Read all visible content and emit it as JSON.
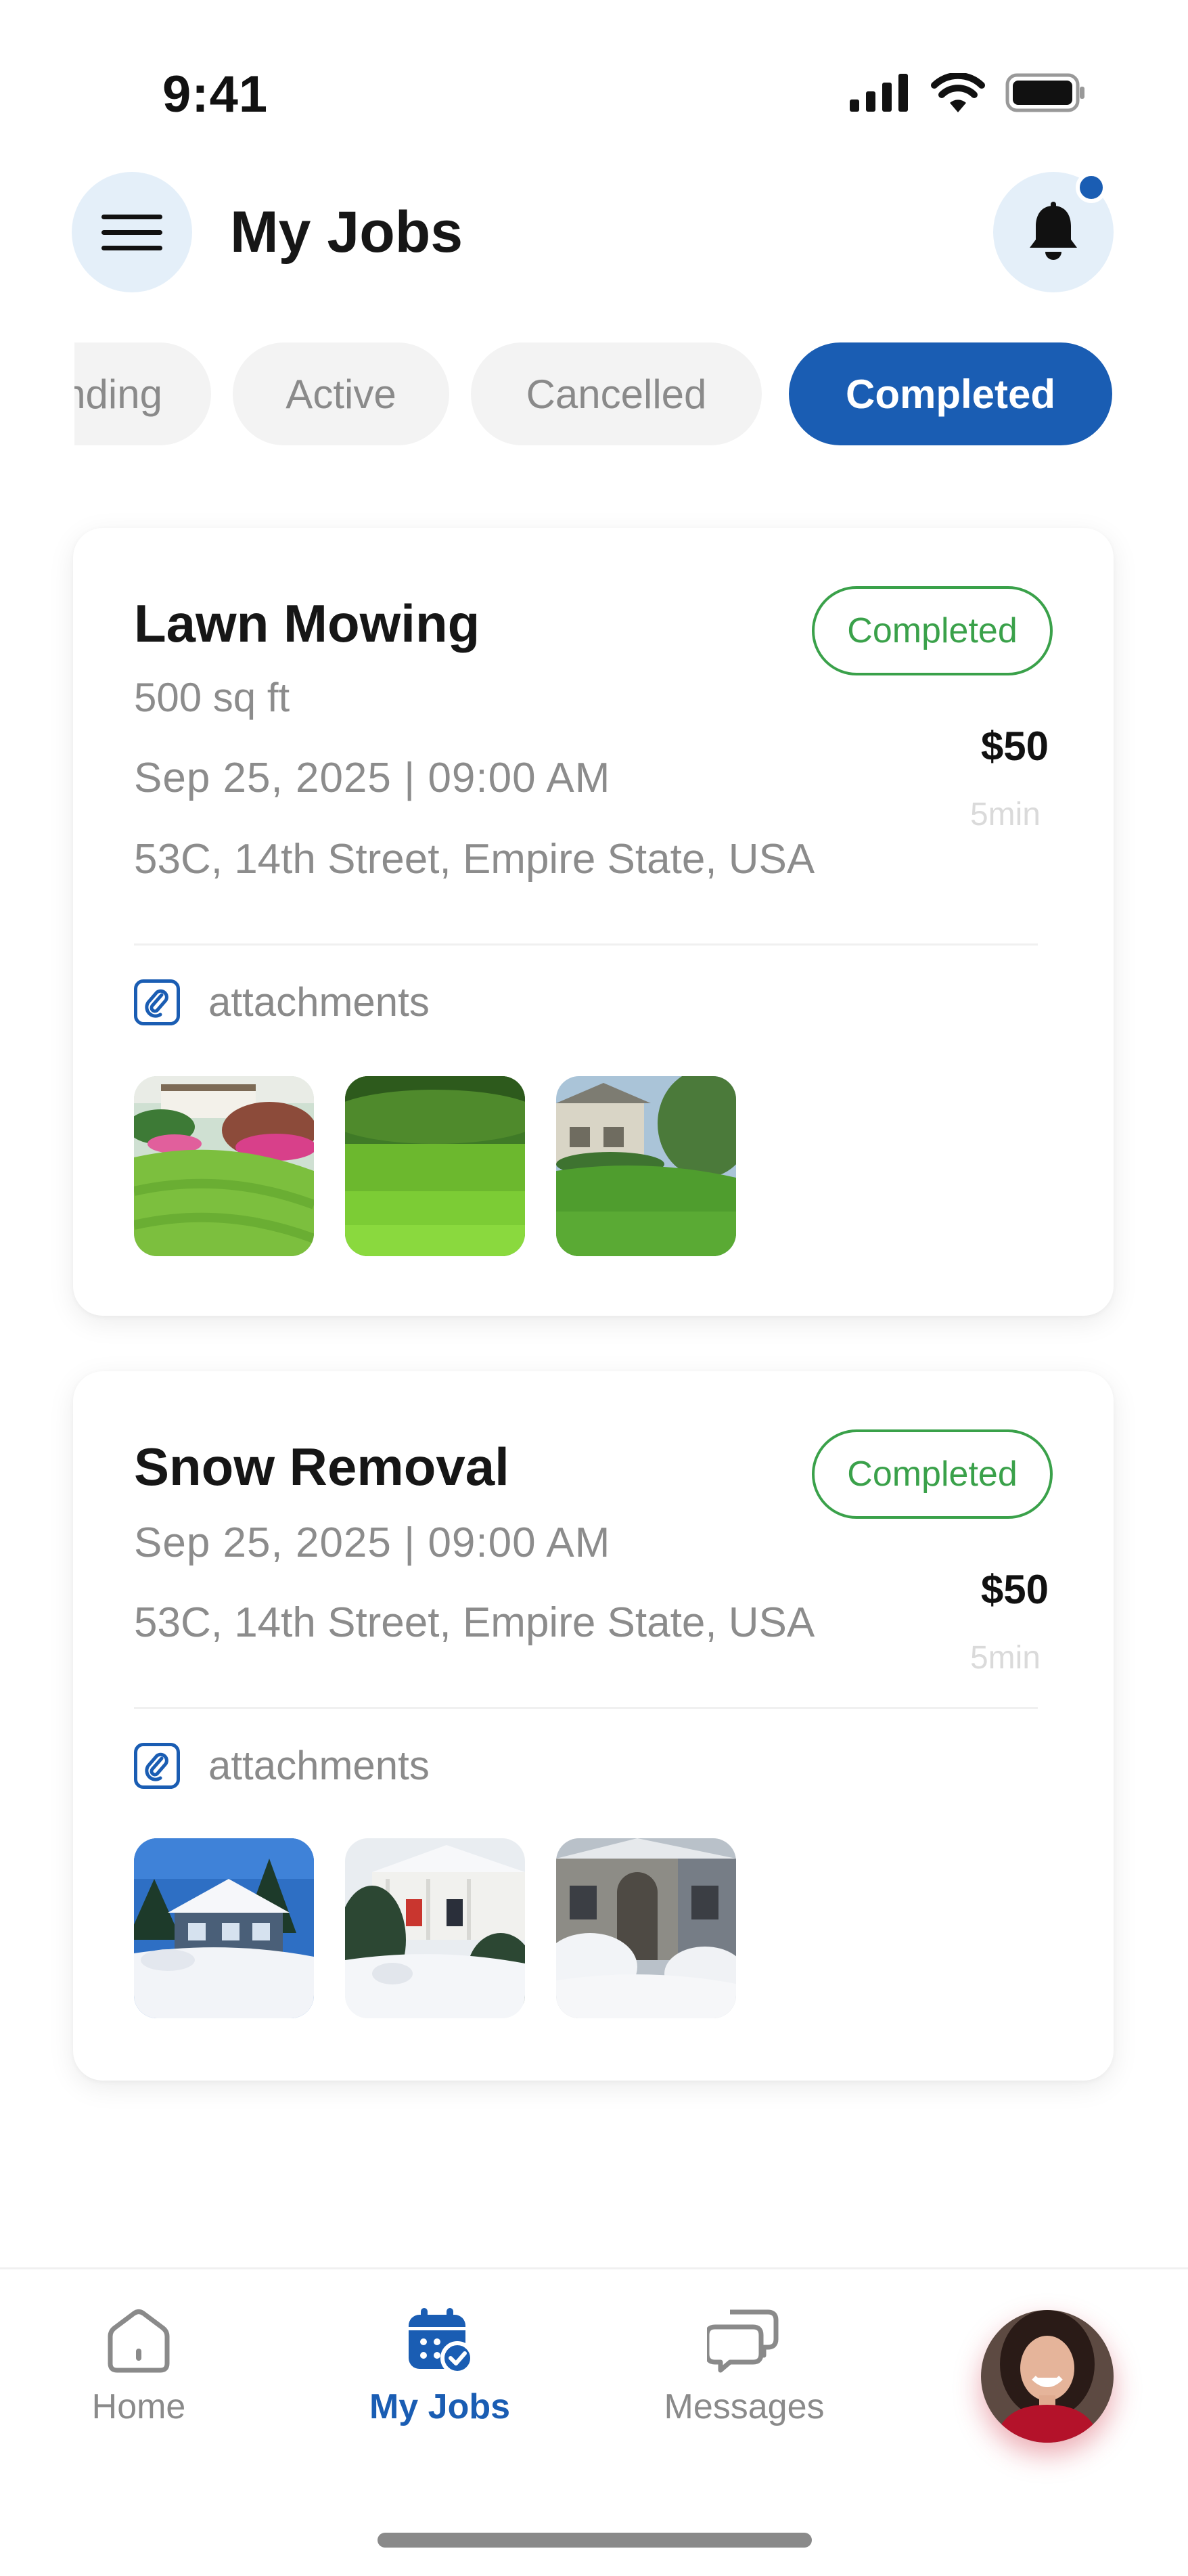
{
  "status_bar": {
    "time": "9:41"
  },
  "header": {
    "title": "My Jobs"
  },
  "tabs": [
    {
      "label": "Pending",
      "visible_text": "nding",
      "active": false
    },
    {
      "label": "Active",
      "active": false
    },
    {
      "label": "Cancelled",
      "active": false
    },
    {
      "label": "Completed",
      "active": true
    }
  ],
  "jobs": [
    {
      "title": "Lawn Mowing",
      "size": "500 sq ft",
      "date": "Sep 25, 2025  |  09:00 AM",
      "address": "53C, 14th Street, Empire State, USA",
      "status": "Completed",
      "price": "$50",
      "duration": "5min",
      "attachments_label": "attachments",
      "attachments": [
        "garden-lawn-photo",
        "close-grass-photo",
        "house-lawn-photo"
      ]
    },
    {
      "title": "Snow Removal",
      "date": "Sep 25, 2025  |  09:00 AM",
      "address": "53C, 14th Street, Empire State, USA",
      "status": "Completed",
      "price": "$50",
      "duration": "5min",
      "attachments_label": "attachments",
      "attachments": [
        "snowy-house-photo",
        "snowy-porch-photo",
        "snowy-yard-photo"
      ]
    }
  ],
  "bottom_nav": [
    {
      "label": "Home",
      "icon": "home-icon",
      "active": false
    },
    {
      "label": "My Jobs",
      "icon": "calendar-check-icon",
      "active": true
    },
    {
      "label": "Messages",
      "icon": "chat-bubbles-icon",
      "active": false
    }
  ],
  "colors": {
    "primary": "#1a5db3",
    "success": "#3aa14a",
    "muted": "#8a8a8a",
    "surface": "#e4eff9"
  }
}
